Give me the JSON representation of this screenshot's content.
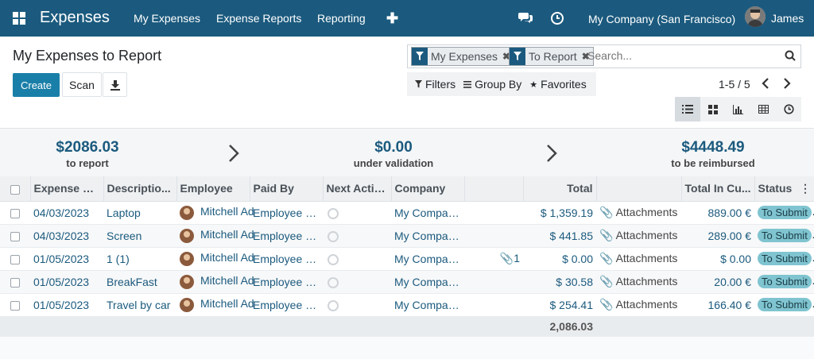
{
  "navbar": {
    "app_name": "Expenses",
    "menu": [
      "My Expenses",
      "Expense Reports",
      "Reporting"
    ],
    "plus": "✚",
    "company": "My Company (San Francisco)",
    "user": "James"
  },
  "page": {
    "title": "My Expenses to Report",
    "create_label": "Create",
    "scan_label": "Scan"
  },
  "search": {
    "facets": [
      "My Expenses",
      "To Report"
    ],
    "placeholder": "Search..."
  },
  "filters": {
    "filters_label": "Filters",
    "groupby_label": "Group By",
    "favorites_label": "Favorites"
  },
  "pager": {
    "value": "1-5 / 5"
  },
  "summary": [
    {
      "amount": "$2086.03",
      "label": "to report"
    },
    {
      "amount": "$0.00",
      "label": "under validation"
    },
    {
      "amount": "$4448.49",
      "label": "to be reimbursed"
    }
  ],
  "table": {
    "headers": {
      "date": "Expense D...",
      "description": "Descriptio...",
      "employee": "Employee",
      "paid_by": "Paid By",
      "next_activity": "Next Activ...",
      "company": "Company",
      "total": "Total",
      "total_currency": "Total In Cu...",
      "status": "Status"
    },
    "rows": [
      {
        "date": "04/03/2023",
        "description": "Laptop",
        "employee": "Mitchell Ad",
        "paid_by": "Employee (t...",
        "company": "My Compan...",
        "attachment_count": "",
        "total": "$ 1,359.19",
        "attachments": "Attachments",
        "total_currency": "889.00 €",
        "status": "To Submit"
      },
      {
        "date": "04/03/2023",
        "description": "Screen",
        "employee": "Mitchell Ad",
        "paid_by": "Employee (t...",
        "company": "My Compan...",
        "attachment_count": "",
        "total": "$ 441.85",
        "attachments": "Attachments",
        "total_currency": "289.00 €",
        "status": "To Submit"
      },
      {
        "date": "01/05/2023",
        "description": "1 (1)",
        "employee": "Mitchell Ad",
        "paid_by": "Employee (t...",
        "company": "My Compan...",
        "attachment_count": "1",
        "total": "$ 0.00",
        "attachments": "Attachments",
        "total_currency": "$ 0.00",
        "status": "To Submit"
      },
      {
        "date": "01/05/2023",
        "description": "BreakFast",
        "employee": "Mitchell Ad",
        "paid_by": "Employee (t...",
        "company": "My Compan...",
        "attachment_count": "",
        "total": "$ 30.58",
        "attachments": "Attachments",
        "total_currency": "20.00 €",
        "status": "To Submit"
      },
      {
        "date": "01/05/2023",
        "description": "Travel by car",
        "employee": "Mitchell Ad",
        "paid_by": "Employee (t...",
        "company": "My Compan...",
        "attachment_count": "",
        "total": "$ 254.41",
        "attachments": "Attachments",
        "total_currency": "166.40 €",
        "status": "To Submit"
      }
    ],
    "footer_total": "2,086.03"
  },
  "colors": {
    "navbar": "#1b5a7e",
    "primary_button": "#1a7fa8",
    "status_badge": "#7fc4d0",
    "summary_amount": "#1b5a7e"
  }
}
